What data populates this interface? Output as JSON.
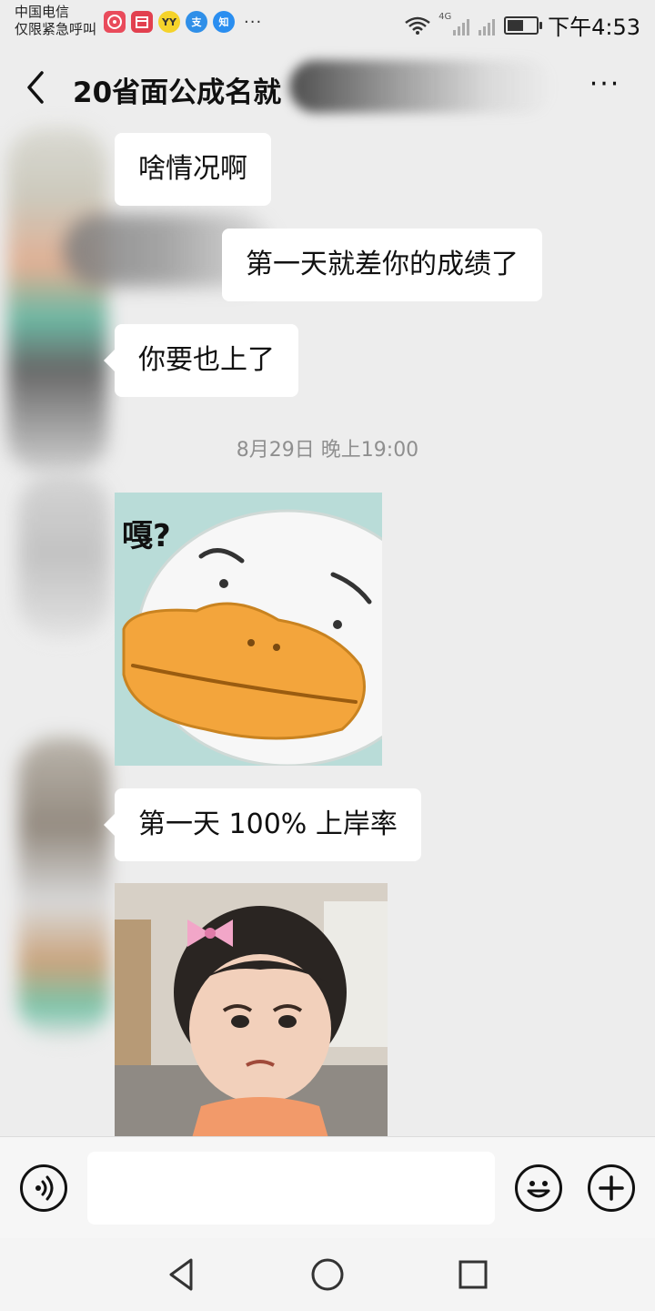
{
  "status_bar": {
    "carrier_line1": "中国电信",
    "carrier_line2": "仅限紧急呼叫",
    "app_icons": [
      "zhengzhou-app-icon",
      "calendar-icon",
      "yy-icon",
      "alipay-icon",
      "zhihu-icon"
    ],
    "app_labels": [
      "",
      "",
      "YY",
      "支",
      "知"
    ],
    "more": "···",
    "network": "4G",
    "battery_level": 0.55,
    "time": "下午4:53"
  },
  "header": {
    "title": "20省面公成名就",
    "more_label": "···"
  },
  "messages": [
    {
      "text": "啥情况啊"
    },
    {
      "text": "第一天就差你的成绩了"
    },
    {
      "text": "你要也上了"
    },
    {
      "timestamp": "8月29日 晚上19:00"
    },
    {
      "sticker_caption": "嘎?"
    },
    {
      "text": "第一天 100% 上岸率"
    }
  ],
  "colors": {
    "background": "#ededed",
    "bubble": "#ffffff",
    "duck_bg": "#b9dcd8",
    "duck_beak": "#f3a53c"
  }
}
